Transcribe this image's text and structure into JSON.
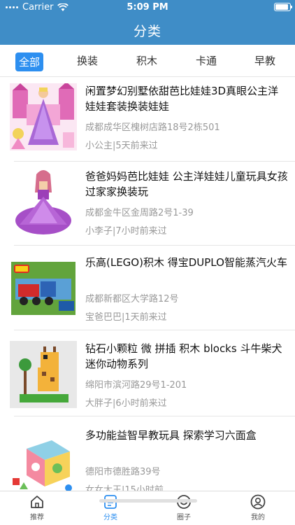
{
  "status_bar": {
    "carrier": "Carrier",
    "time": "5:09 PM"
  },
  "header": {
    "title": "分类"
  },
  "tabs": [
    {
      "label": "全部",
      "active": true
    },
    {
      "label": "换装",
      "active": false
    },
    {
      "label": "积木",
      "active": false
    },
    {
      "label": "卡通",
      "active": false
    },
    {
      "label": "早教",
      "active": false
    }
  ],
  "items": [
    {
      "title": "闲置梦幻别墅依甜芭比娃娃3D真眼公主洋娃娃套装换装娃娃",
      "address": "成都成华区槐树店路18号2栋501",
      "user_time": "小公主|5天前来过"
    },
    {
      "title": "爸爸妈妈芭比娃娃 公主洋娃娃儿童玩具女孩过家家换装玩",
      "address": "成都金牛区金周路2号1-39",
      "user_time": "小李子|7小时前来过"
    },
    {
      "title": "乐高(LEGO)积木 得宝DUPLO智能蒸汽火车",
      "address": "成都新都区大学路12号",
      "user_time": "宝爸巴巴|1天前来过"
    },
    {
      "title": "钻石小颗粒 微 拼插 积木 blocks 斗牛柴犬迷你动物系列",
      "address": "绵阳市滨河路29号1-201",
      "user_time": "大胖子|6小时前来过"
    },
    {
      "title": "多功能益智早教玩具 探索学习六面盒",
      "address": "德阳市德胜路39号",
      "user_time": "女女大王|15小时前"
    }
  ],
  "tabbar": [
    {
      "label": "推荐",
      "icon": "home-icon",
      "active": false
    },
    {
      "label": "分类",
      "icon": "category-list-icon",
      "active": true
    },
    {
      "label": "圈子",
      "icon": "smile-circle-icon",
      "active": false
    },
    {
      "label": "我的",
      "icon": "user-icon",
      "active": false
    }
  ],
  "colors": {
    "primary": "#3f8dc7",
    "accent": "#2d8ff0",
    "muted_text": "#999999"
  }
}
